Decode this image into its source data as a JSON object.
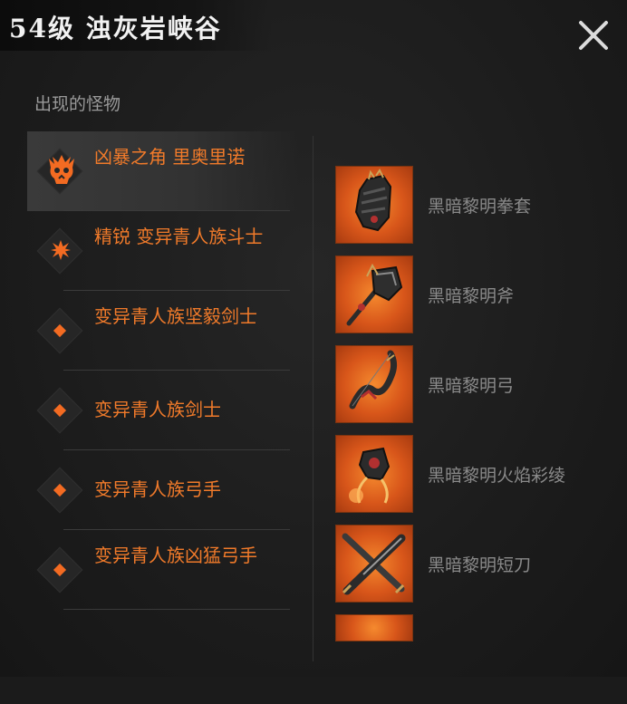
{
  "header": {
    "title": "54级 浊灰岩峡谷",
    "close_icon": "close-icon"
  },
  "section": {
    "label": "出现的怪物"
  },
  "colors": {
    "accent": "#f07a2a",
    "muted_text": "#8a8a8a",
    "background": "#1c1c1c"
  },
  "monsters": [
    {
      "name": "凶暴之角 里奥里诺",
      "icon": "boss-skull-icon",
      "selected": true
    },
    {
      "name": "精锐 变异青人族斗士",
      "icon": "elite-star-icon",
      "selected": false
    },
    {
      "name": "变异青人族坚毅剑士",
      "icon": "diamond-marker-icon",
      "selected": false
    },
    {
      "name": "变异青人族剑士",
      "icon": "diamond-marker-icon",
      "selected": false
    },
    {
      "name": "变异青人族弓手",
      "icon": "diamond-marker-icon",
      "selected": false
    },
    {
      "name": "变异青人族凶猛弓手",
      "icon": "diamond-marker-icon",
      "selected": false
    }
  ],
  "loot": [
    {
      "name": "黑暗黎明拳套",
      "icon": "gauntlet-icon"
    },
    {
      "name": "黑暗黎明斧",
      "icon": "axe-icon"
    },
    {
      "name": "黑暗黎明弓",
      "icon": "bow-icon"
    },
    {
      "name": "黑暗黎明火焰彩绫",
      "icon": "sash-icon"
    },
    {
      "name": "黑暗黎明短刀",
      "icon": "daggers-icon"
    },
    {
      "name": "",
      "icon": "item-partial-icon"
    }
  ]
}
